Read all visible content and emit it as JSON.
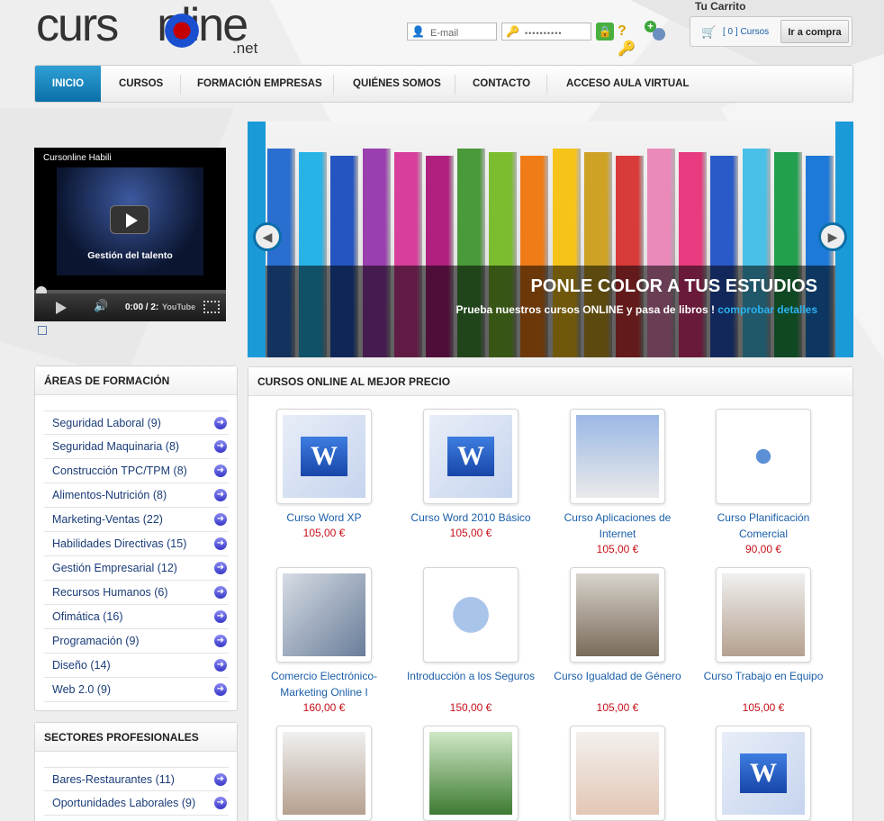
{
  "brand": {
    "logo_left": "curs",
    "logo_right": "nline",
    "logo_domain": ".net"
  },
  "login": {
    "email_placeholder": "E-mail",
    "password_mask": "••••••••••"
  },
  "cart": {
    "title": "Tu Carrito",
    "count_text": "[ 0 ] Cursos",
    "button": "Ir a compra"
  },
  "nav": {
    "items": [
      "INICIO",
      "CURSOS",
      "FORMACIÓN EMPRESAS",
      "QUIÉNES SOMOS",
      "CONTACTO",
      "ACCESO AULA VIRTUAL"
    ]
  },
  "video": {
    "title": "Cursonline Habili",
    "overlay_text": "Gestión del talento",
    "time": "0:00 / 2:",
    "platform": "YouTube"
  },
  "slider": {
    "headline": "PONLE COLOR A TUS ESTUDIOS",
    "subtext": "Prueba nuestros cursos ONLINE y pasa de libros !",
    "link_text": "comprobar detalles",
    "book_colors": [
      "#2a6fd0",
      "#27b3e6",
      "#2455c0",
      "#9a3fb0",
      "#d83f9c",
      "#b0207e",
      "#4a9a3a",
      "#7bbd2f",
      "#f07c18",
      "#f6c419",
      "#cda225",
      "#d93a3a",
      "#e98abb",
      "#e83b80",
      "#2a59c8",
      "#48c0e8",
      "#22a04e",
      "#1e7ad8"
    ]
  },
  "areas": {
    "title": "ÁREAS DE FORMACIÓN",
    "items": [
      "Seguridad Laboral (9)",
      "Seguridad Maquinaria (8)",
      "Construcción TPC/TPM (8)",
      "Alimentos-Nutrición (8)",
      "Marketing-Ventas (22)",
      "Habilidades Directivas (15)",
      "Gestión Empresarial (12)",
      "Recursos Humanos (6)",
      "Ofimática (16)",
      "Programación (9)",
      "Diseño (14)",
      "Web 2.0 (9)"
    ]
  },
  "sectors": {
    "title": "SECTORES PROFESIONALES",
    "items": [
      "Bares-Restaurantes (11)",
      "Oportunidades Laborales (9)"
    ]
  },
  "courses": {
    "title": "CURSOS ONLINE AL MEJOR PRECIO",
    "items": [
      {
        "name": "Curso Word XP",
        "price": "105,00 €",
        "icon": "word-document-icon"
      },
      {
        "name": "Curso Word 2010 Básico",
        "price": "105,00 €",
        "icon": "word-document-icon"
      },
      {
        "name": "Curso Aplicaciones de Internet",
        "price": "105,00 €",
        "icon": "internet-apps-image"
      },
      {
        "name": "Curso Planificación Comercial",
        "price": "90,00 €",
        "icon": "network-people-image"
      },
      {
        "name": "Comercio Electrónico-Marketing Online I",
        "price": "160,00 €",
        "icon": "ecommerce-image"
      },
      {
        "name": "Introducción a los Seguros",
        "price": "150,00 €",
        "icon": "lock-network-image"
      },
      {
        "name": "Curso Igualdad de Género",
        "price": "105,00 €",
        "icon": "meeting-image"
      },
      {
        "name": "Curso Trabajo en Equipo",
        "price": "105,00 €",
        "icon": "team-image"
      },
      {
        "name": "",
        "price": "",
        "icon": "team-image"
      },
      {
        "name": "",
        "price": "",
        "icon": "truck-image"
      },
      {
        "name": "",
        "price": "",
        "icon": "card-image"
      },
      {
        "name": "",
        "price": "",
        "icon": "word-document-icon"
      }
    ]
  },
  "colors": {
    "accent": "#1b9ad8",
    "price": "#c8101a",
    "link": "#1a5ea8"
  }
}
